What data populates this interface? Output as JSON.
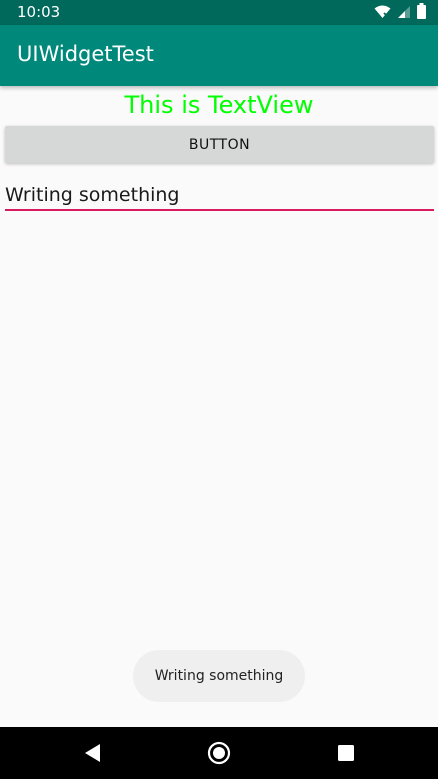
{
  "status_bar": {
    "time": "10:03",
    "icons": [
      "wifi-icon",
      "cell-signal-icon",
      "battery-icon"
    ]
  },
  "app_bar": {
    "title": "UIWidgetTest",
    "color": "#00897b"
  },
  "main": {
    "textview_text": "This is TextView",
    "textview_color": "#00ff00",
    "button_label": "BUTTON",
    "edittext_value": "Writing something",
    "edittext_underline_color": "#d81b60"
  },
  "toast": {
    "text": "Writing something"
  },
  "nav_bar": {
    "buttons": [
      "back-icon",
      "home-icon",
      "recents-icon"
    ]
  }
}
